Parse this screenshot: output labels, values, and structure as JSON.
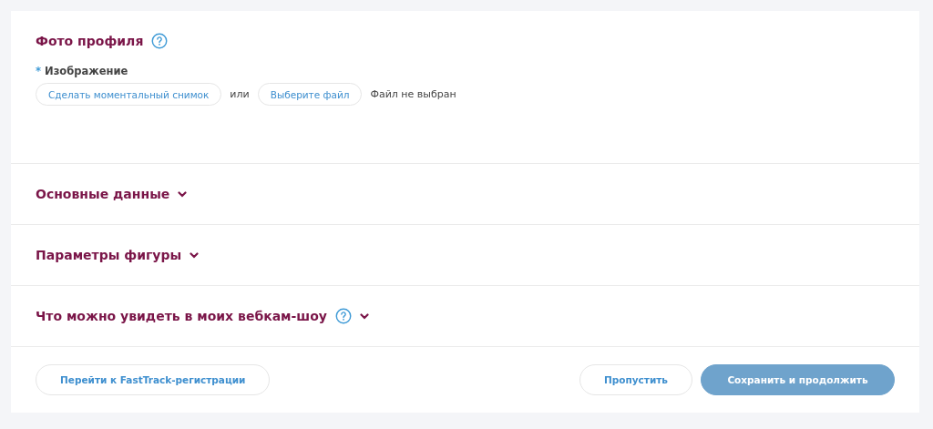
{
  "profile_photo": {
    "title": "Фото профиля",
    "help": true,
    "required_mark": "*",
    "field_label": "Изображение",
    "snapshot_button": "Сделать моментальный снимок",
    "or_text": "или",
    "file_button": "Выберите файл",
    "file_status": "Файл не выбран"
  },
  "sections": [
    {
      "title": "Основные данные",
      "help": false,
      "expanded": false
    },
    {
      "title": "Параметры фигуры",
      "help": false,
      "expanded": false
    },
    {
      "title": "Что можно увидеть в моих вебкам-шоу",
      "help": true,
      "expanded": false
    }
  ],
  "footer": {
    "fasttrack_button": "Перейти к FastTrack-регистрации",
    "skip_button": "Пропустить",
    "save_button": "Сохранить и продолжить"
  }
}
